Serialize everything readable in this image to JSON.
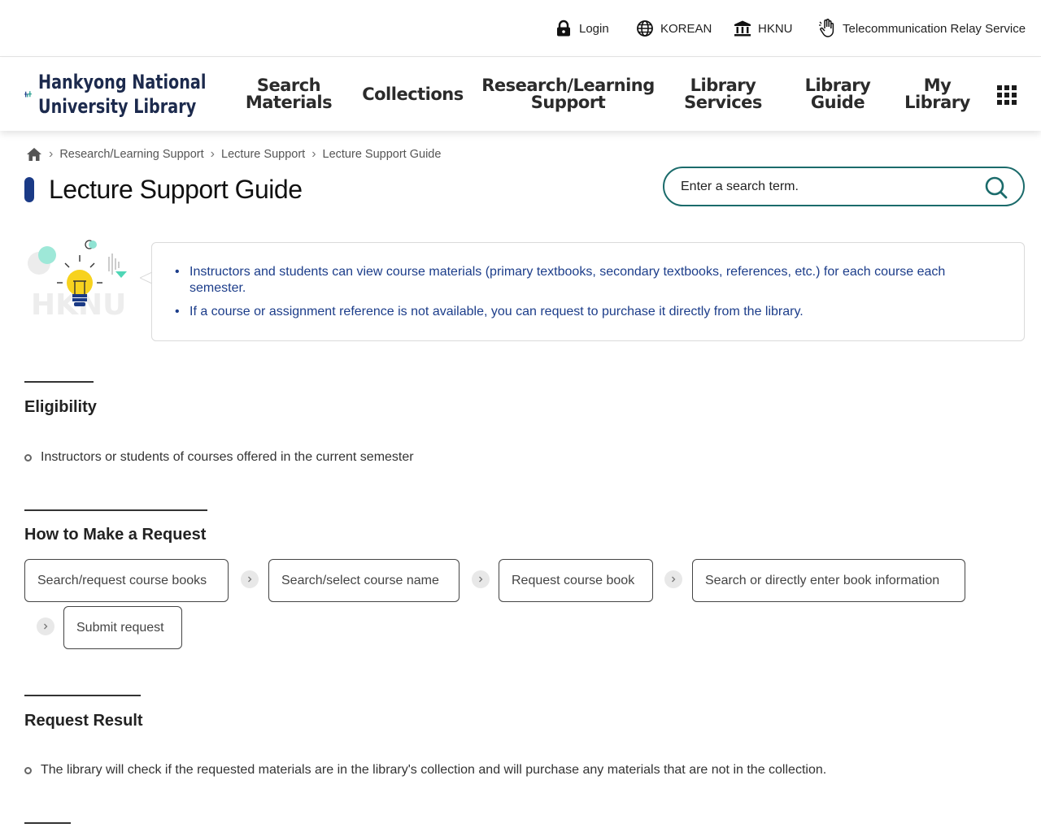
{
  "utility": {
    "login": "Login",
    "language": "KOREAN",
    "hknu": "HKNU",
    "relay": "Telecommunication Relay Service"
  },
  "logo": {
    "line1": "Hankyong National",
    "line2": "University Library"
  },
  "nav": {
    "search_materials": "Search\nMaterials",
    "collections": "Collections",
    "research": "Research/Learning\nSupport",
    "library_services": "Library\nServices",
    "library_guide": "Library\nGuide",
    "my_library": "My\nLibrary"
  },
  "breadcrumb": [
    "Research/Learning Support",
    "Lecture Support",
    "Lecture Support Guide"
  ],
  "page_title": "Lecture Support Guide",
  "search": {
    "placeholder": "Enter a search term."
  },
  "info": {
    "illustration_text": "HKNU",
    "items": [
      "Instructors and students can view course materials (primary textbooks, secondary textbooks, references, etc.) for each course each semester.",
      "If a course or assignment reference is not available, you can request to purchase it directly from the library."
    ]
  },
  "eligibility": {
    "title": "Eligibility",
    "items": [
      "Instructors or students of courses offered in the current semester"
    ]
  },
  "how_to": {
    "title": "How to Make a Request",
    "steps": [
      "Search/request course books",
      "Search/select course name",
      "Request course book",
      "Search or directly enter book information",
      "Submit request"
    ]
  },
  "result": {
    "title": "Request Result",
    "items": [
      "The library will check if the requested materials are in the library's collection and will purchase any materials that are not in the collection."
    ]
  },
  "colors": {
    "accent_navy": "#1a3a86",
    "search_border": "#1b6b6b",
    "info_text": "#1c3d8a",
    "logo_teal": "#1a9a8a"
  }
}
